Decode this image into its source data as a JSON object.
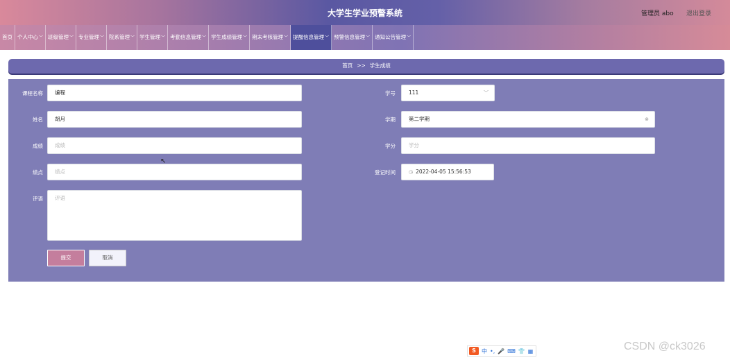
{
  "header": {
    "title": "大学生学业预警系统",
    "user": "管理员 abo",
    "logout": "退出登录"
  },
  "nav": {
    "items": [
      {
        "label": "首页",
        "dropdown": false
      },
      {
        "label": "个人中心",
        "dropdown": true
      },
      {
        "label": "班级管理",
        "dropdown": true
      },
      {
        "label": "专业管理",
        "dropdown": true
      },
      {
        "label": "院系管理",
        "dropdown": true
      },
      {
        "label": "学生管理",
        "dropdown": true
      },
      {
        "label": "考勤信息管理",
        "dropdown": true
      },
      {
        "label": "学生成绩管理",
        "dropdown": true
      },
      {
        "label": "期末考核管理",
        "dropdown": true
      },
      {
        "label": "提醒信息管理",
        "dropdown": true
      },
      {
        "label": "预警信息管理",
        "dropdown": true
      },
      {
        "label": "通知公告管理",
        "dropdown": true
      }
    ],
    "active_index": 9
  },
  "breadcrumb": {
    "home": "首页",
    "separator": ">>",
    "current": "学生成绩"
  },
  "form": {
    "course_label": "课程名称",
    "course_value": "编程",
    "student_no_label": "学号",
    "student_no_value": "111",
    "name_label": "姓名",
    "name_value": "胡月",
    "term_label": "学期",
    "term_value": "第二学期",
    "score_label": "成绩",
    "score_placeholder": "成绩",
    "credit_label": "学分",
    "credit_placeholder": "学分",
    "gpa_label": "绩点",
    "gpa_placeholder": "绩点",
    "record_time_label": "登记时间",
    "record_time_value": "2022-04-05 15:56:53",
    "comment_label": "评语",
    "comment_placeholder": "评语",
    "submit_label": "提交",
    "cancel_label": "取消"
  },
  "ime": {
    "items": [
      "S",
      "中",
      "•,",
      "🎤",
      "⌨",
      "👕",
      "▦"
    ]
  },
  "watermark": "CSDN @ck3026",
  "colors": {
    "panel": "#7f7db6",
    "breadcrumb": "#6d69ae",
    "submit": "#c47e9d",
    "nav_active": "#4e4f9c"
  }
}
